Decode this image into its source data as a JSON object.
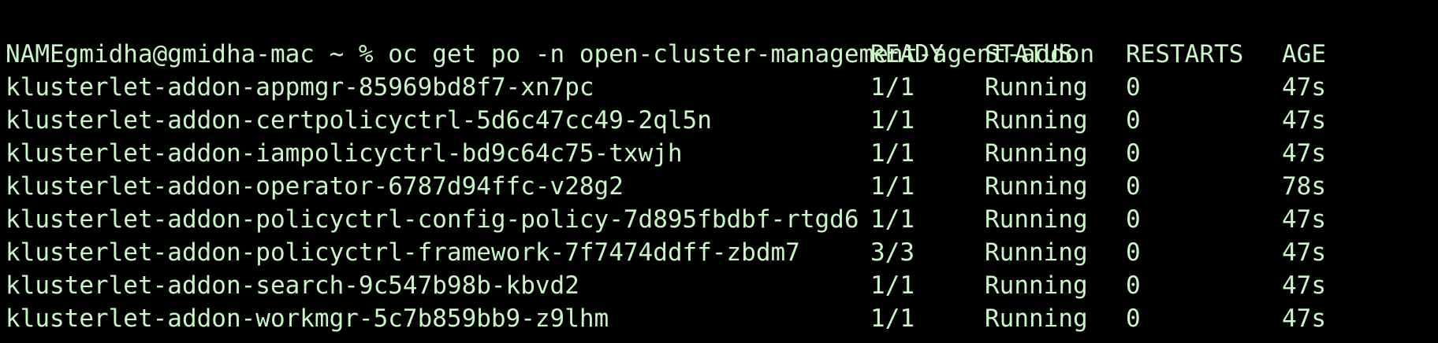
{
  "prompt_line": "gmidha@gmidha-mac ~ % oc get po -n open-cluster-management-agent-addon",
  "headers": {
    "name": "NAME",
    "ready": "READY",
    "status": "STATUS",
    "restarts": "RESTARTS",
    "age": "AGE"
  },
  "pods": [
    {
      "name": "klusterlet-addon-appmgr-85969bd8f7-xn7pc",
      "ready": "1/1",
      "status": "Running",
      "restarts": "0",
      "age": "47s"
    },
    {
      "name": "klusterlet-addon-certpolicyctrl-5d6c47cc49-2ql5n",
      "ready": "1/1",
      "status": "Running",
      "restarts": "0",
      "age": "47s"
    },
    {
      "name": "klusterlet-addon-iampolicyctrl-bd9c64c75-txwjh",
      "ready": "1/1",
      "status": "Running",
      "restarts": "0",
      "age": "47s"
    },
    {
      "name": "klusterlet-addon-operator-6787d94ffc-v28g2",
      "ready": "1/1",
      "status": "Running",
      "restarts": "0",
      "age": "78s"
    },
    {
      "name": "klusterlet-addon-policyctrl-config-policy-7d895fbdbf-rtgd6",
      "ready": "1/1",
      "status": "Running",
      "restarts": "0",
      "age": "47s"
    },
    {
      "name": "klusterlet-addon-policyctrl-framework-7f7474ddff-zbdm7",
      "ready": "3/3",
      "status": "Running",
      "restarts": "0",
      "age": "47s"
    },
    {
      "name": "klusterlet-addon-search-9c547b98b-kbvd2",
      "ready": "1/1",
      "status": "Running",
      "restarts": "0",
      "age": "47s"
    },
    {
      "name": "klusterlet-addon-workmgr-5c7b859bb9-z9lhm",
      "ready": "1/1",
      "status": "Running",
      "restarts": "0",
      "age": "47s"
    }
  ],
  "colors": {
    "background": "#000000",
    "foreground": "#c8f7c5"
  }
}
